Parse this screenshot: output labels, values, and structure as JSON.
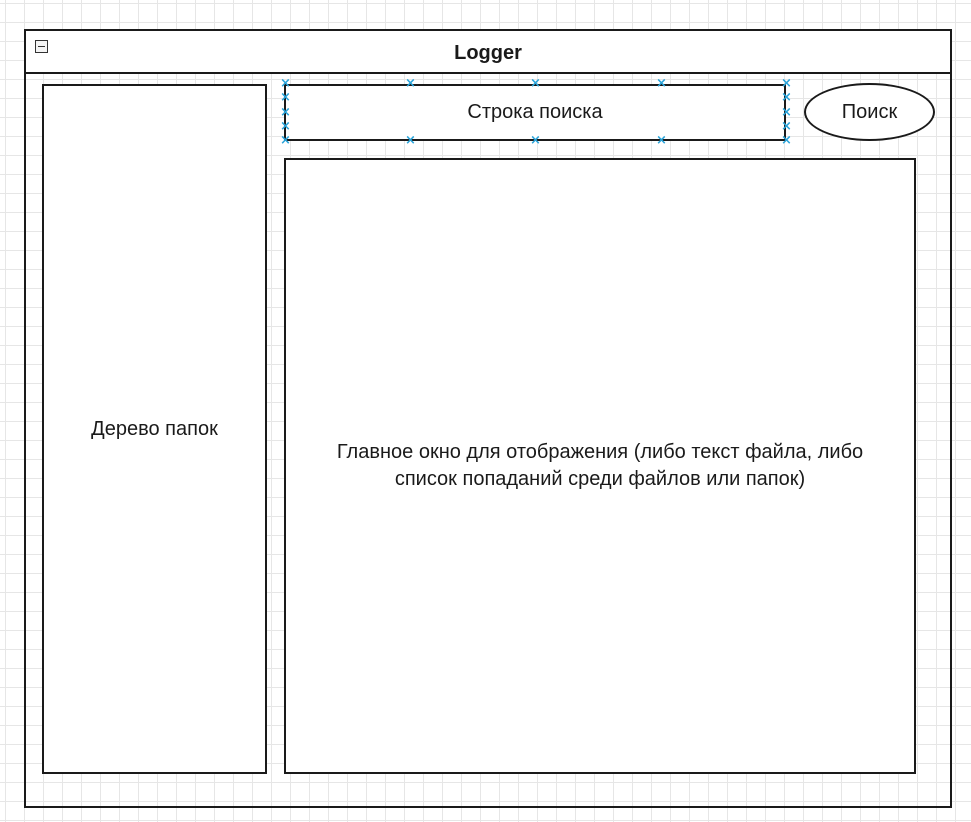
{
  "window": {
    "title": "Logger"
  },
  "panels": {
    "folder_tree": "Дерево папок",
    "search_input": "Строка поиска",
    "search_button": "Поиск",
    "main_view": "Главное окно для отображения (либо текст файла, либо список попаданий среди файлов или папок)"
  },
  "icons": {
    "collapse": "collapse-icon",
    "selection_handle": "selection-handle-icon"
  },
  "colors": {
    "border": "#1a1a1a",
    "grid": "#e6e6e6",
    "selection": "#29a3d9"
  }
}
